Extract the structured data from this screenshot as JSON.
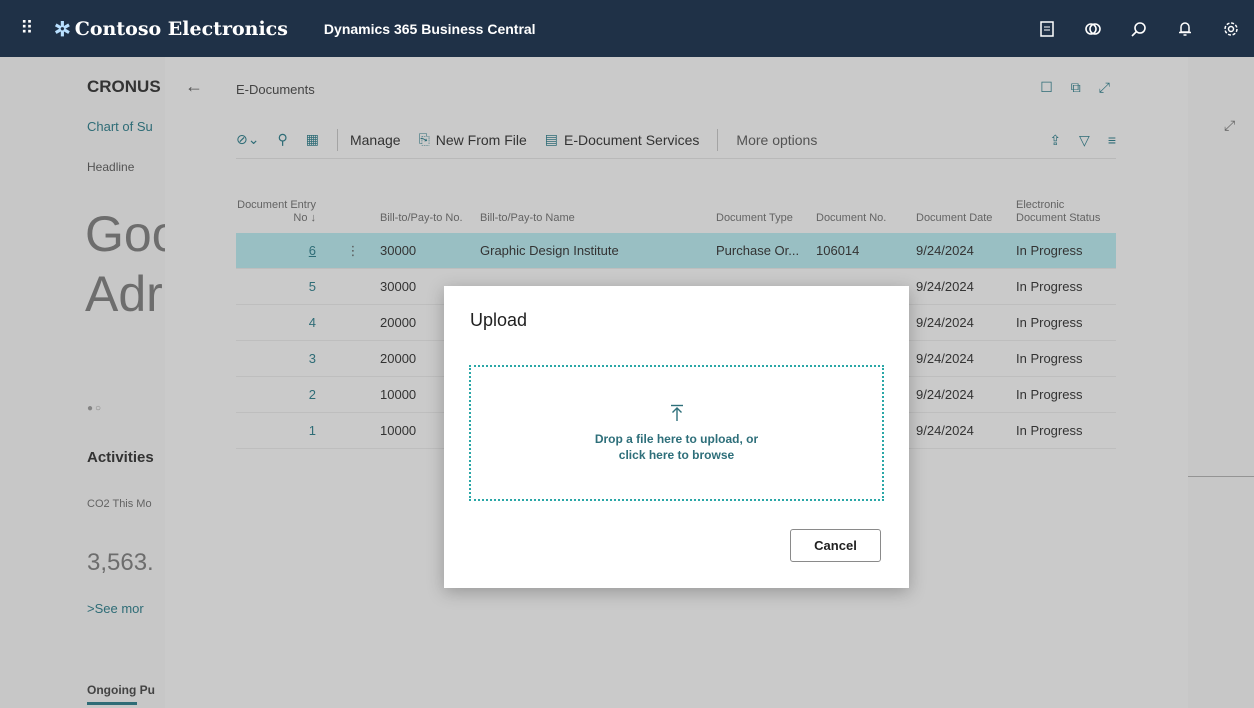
{
  "topbar": {
    "brand": "Contoso Electronics",
    "product": "Dynamics 365 Business Central",
    "icons": [
      "report-icon",
      "copilot-icon",
      "search-icon",
      "bell-icon",
      "gear-icon"
    ]
  },
  "rolecenter": {
    "company": "CRONUS",
    "link": "Chart of Su",
    "headline_label": "Headline",
    "greeting_line1": "Goo",
    "greeting_line2": "Adr",
    "activities": "Activities",
    "co2_label": "CO2 This Mo",
    "co2_value": "3,563.",
    "see_more": "See mor",
    "ongoing": "Ongoing Pu"
  },
  "panel": {
    "title": "E-Documents",
    "actions": {
      "manage": "Manage",
      "new_from_file": "New From File",
      "services": "E-Document Services",
      "more": "More options"
    },
    "columns": {
      "entry_no": "Document Entry No ↓",
      "bill_to_no": "Bill-to/Pay-to No.",
      "bill_to_name": "Bill-to/Pay-to Name",
      "doc_type": "Document Type",
      "doc_no": "Document No.",
      "doc_date": "Document Date",
      "status": "Electronic Document Status"
    },
    "rows": [
      {
        "entry": "6",
        "no": "30000",
        "name": "Graphic Design Institute",
        "type": "Purchase Or...",
        "docno": "106014",
        "date": "9/24/2024",
        "status": "In Progress"
      },
      {
        "entry": "5",
        "no": "30000",
        "name": "",
        "type": "",
        "docno": "",
        "date": "9/24/2024",
        "status": "In Progress"
      },
      {
        "entry": "4",
        "no": "20000",
        "name": "",
        "type": "",
        "docno": "",
        "date": "9/24/2024",
        "status": "In Progress"
      },
      {
        "entry": "3",
        "no": "20000",
        "name": "",
        "type": "",
        "docno": "",
        "date": "9/24/2024",
        "status": "In Progress"
      },
      {
        "entry": "2",
        "no": "10000",
        "name": "",
        "type": "",
        "docno": "",
        "date": "9/24/2024",
        "status": "In Progress"
      },
      {
        "entry": "1",
        "no": "10000",
        "name": "",
        "type": "",
        "docno": "",
        "date": "9/24/2024",
        "status": "In Progress"
      }
    ]
  },
  "dialog": {
    "title": "Upload",
    "drop_line1": "Drop a file here to upload, or",
    "drop_line2": "click here to browse",
    "cancel": "Cancel"
  },
  "colors": {
    "topbar": "#1f3147",
    "accent": "#2e6f7a",
    "selected_row": "#9fc7cb",
    "dropzone_border": "#2aa7a7"
  }
}
